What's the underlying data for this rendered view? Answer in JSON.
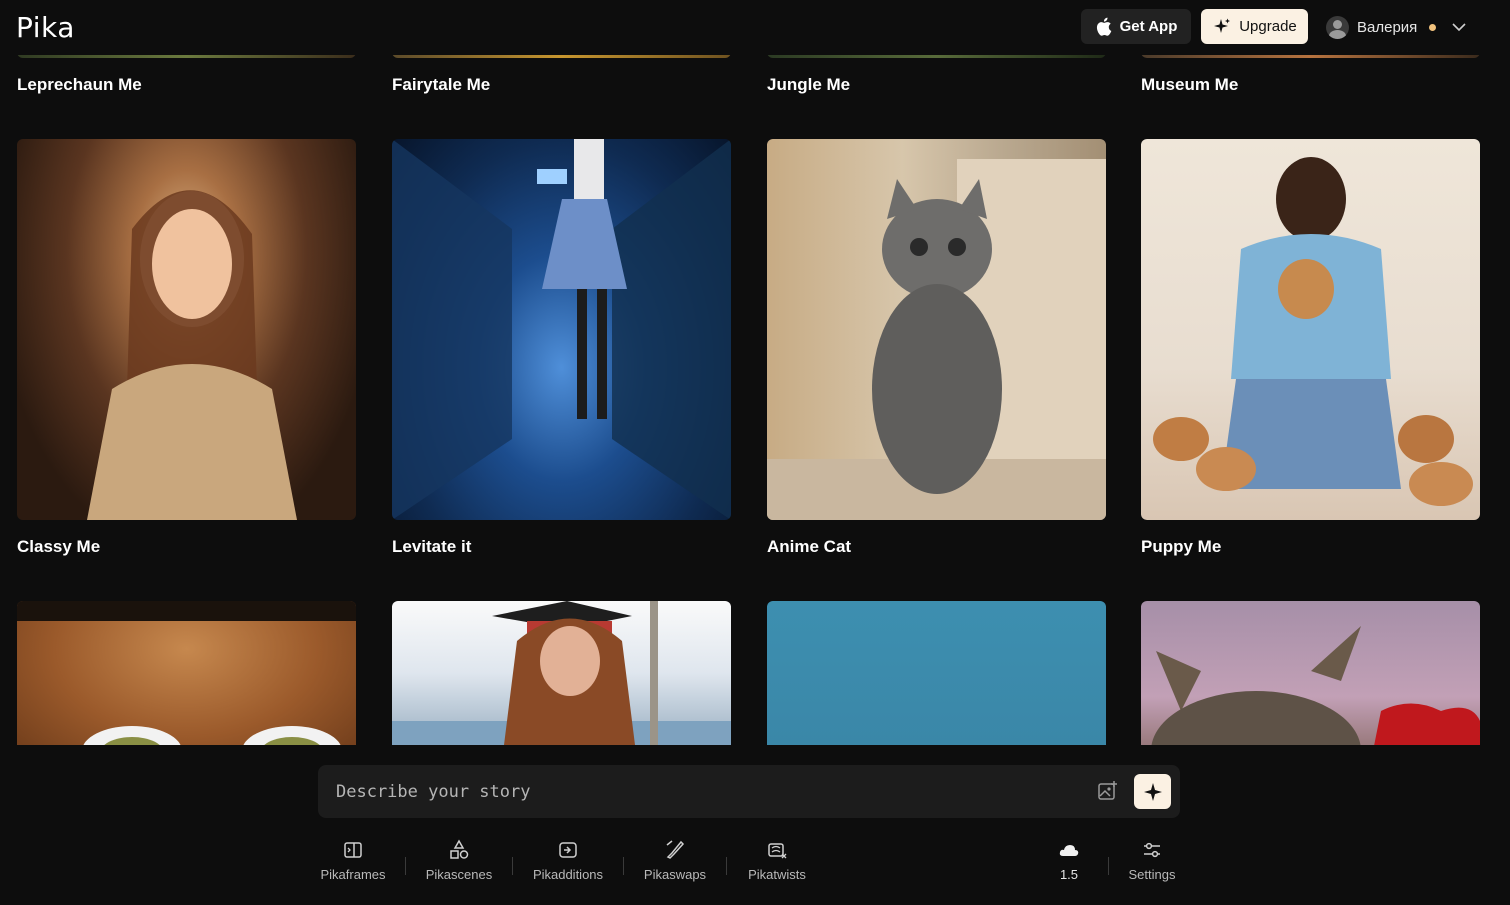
{
  "header": {
    "logo": "Pika",
    "get_app_label": "Get App",
    "upgrade_label": "Upgrade",
    "user_name": "Валерия"
  },
  "cards_row1": [
    {
      "title": "Leprechaun Me"
    },
    {
      "title": "Fairytale Me"
    },
    {
      "title": "Jungle Me"
    },
    {
      "title": "Museum Me"
    }
  ],
  "cards_row2": [
    {
      "title": "Classy Me"
    },
    {
      "title": "Levitate it"
    },
    {
      "title": "Anime Cat"
    },
    {
      "title": "Puppy Me"
    }
  ],
  "composer": {
    "placeholder": "Describe your story"
  },
  "tools": [
    {
      "label": "Pikaframes",
      "icon": "frames-icon"
    },
    {
      "label": "Pikascenes",
      "icon": "shapes-icon"
    },
    {
      "label": "Pikadditions",
      "icon": "add-object-icon"
    },
    {
      "label": "Pikaswaps",
      "icon": "brush-icon"
    },
    {
      "label": "Pikatwists",
      "icon": "twist-icon"
    }
  ],
  "model": {
    "label": "1.5",
    "icon": "cloud-icon"
  },
  "settings": {
    "label": "Settings",
    "icon": "settings-sliders-icon"
  },
  "colors": {
    "background": "#0d0d0d",
    "upgrade_bg": "#fbf1e3",
    "status_dot": "#f1c27d"
  }
}
